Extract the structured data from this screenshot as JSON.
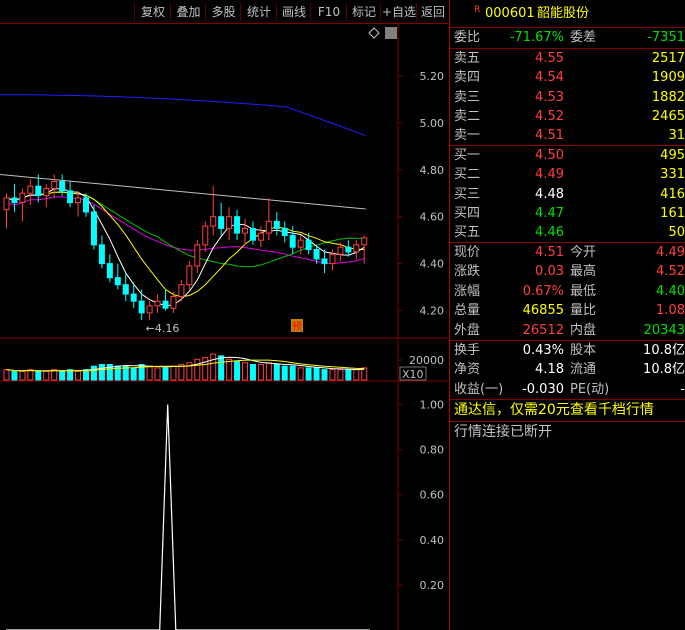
{
  "toolbar": {
    "buttons": [
      "复权",
      "叠加",
      "多股",
      "统计",
      "画线",
      "F10",
      "标记",
      "+自选",
      "返回"
    ]
  },
  "stock": {
    "badge": "R",
    "code": "000601",
    "name": "韶能股份"
  },
  "weibi": {
    "label1": "委比",
    "value1": "-71.67%",
    "label2": "委差",
    "value2": "-7351"
  },
  "asks": [
    {
      "label": "卖五",
      "price": "4.55",
      "vol": "2517"
    },
    {
      "label": "卖四",
      "price": "4.54",
      "vol": "1909"
    },
    {
      "label": "卖三",
      "price": "4.53",
      "vol": "1882"
    },
    {
      "label": "卖二",
      "price": "4.52",
      "vol": "2465"
    },
    {
      "label": "卖一",
      "price": "4.51",
      "vol": "31"
    }
  ],
  "bids": [
    {
      "label": "买一",
      "price": "4.50",
      "vol": "495"
    },
    {
      "label": "买二",
      "price": "4.49",
      "vol": "331"
    },
    {
      "label": "买三",
      "price": "4.48",
      "vol": "416"
    },
    {
      "label": "买四",
      "price": "4.47",
      "vol": "161"
    },
    {
      "label": "买五",
      "price": "4.46",
      "vol": "50"
    }
  ],
  "quote": [
    {
      "l1": "现价",
      "v1": "4.51",
      "l2": "今开",
      "v2": "4.49"
    },
    {
      "l1": "涨跌",
      "v1": "0.03",
      "l2": "最高",
      "v2": "4.52"
    },
    {
      "l1": "涨幅",
      "v1": "0.67%",
      "l2": "最低",
      "v2": "4.40"
    },
    {
      "l1": "总量",
      "v1": "46855",
      "l2": "量比",
      "v2": "1.08"
    },
    {
      "l1": "外盘",
      "v1": "26512",
      "l2": "内盘",
      "v2": "20343"
    }
  ],
  "finance": [
    {
      "l1": "换手",
      "v1": "0.43%",
      "l2": "股本",
      "v2": "10.8亿"
    },
    {
      "l1": "净资",
      "v1": "4.18",
      "l2": "流通",
      "v2": "10.8亿"
    },
    {
      "l1": "收益(一)",
      "v1": "-0.030",
      "l2": "PE(动)",
      "v2": "-"
    }
  ],
  "promo": "通达信，仅需20元查看千档行情",
  "status": "行情连接已断开",
  "colors": {
    "up": "#ff4040",
    "down": "#00e000",
    "ma5": "#ffffff",
    "ma10": "#ffff00",
    "ma20": "#00c000",
    "ma30": "#e000e0",
    "ma60": "#c0c0c0",
    "ma120": "#2020ff",
    "grid": "#800000"
  },
  "chart_data": {
    "type": "candlestick",
    "price_axis": {
      "ticks": [
        "5.20",
        "5.00",
        "4.80",
        "4.60",
        "4.40",
        "4.20"
      ],
      "range": [
        4.1,
        5.4
      ]
    },
    "low_marker": "4.16",
    "event_tag": "预",
    "volume_axis": {
      "tick": "20000",
      "unit": "X10"
    },
    "indicator_axis": {
      "ticks": [
        "1.00",
        "0.80",
        "0.60",
        "0.40",
        "0.20"
      ],
      "range": [
        0,
        1.1
      ]
    },
    "candles": [
      {
        "o": 4.63,
        "h": 4.7,
        "l": 4.55,
        "c": 4.68
      },
      {
        "o": 4.68,
        "h": 4.74,
        "l": 4.62,
        "c": 4.66
      },
      {
        "o": 4.66,
        "h": 4.72,
        "l": 4.58,
        "c": 4.7
      },
      {
        "o": 4.7,
        "h": 4.76,
        "l": 4.65,
        "c": 4.73
      },
      {
        "o": 4.73,
        "h": 4.78,
        "l": 4.66,
        "c": 4.69
      },
      {
        "o": 4.69,
        "h": 4.74,
        "l": 4.64,
        "c": 4.72
      },
      {
        "o": 4.72,
        "h": 4.78,
        "l": 4.68,
        "c": 4.75
      },
      {
        "o": 4.75,
        "h": 4.78,
        "l": 4.69,
        "c": 4.71
      },
      {
        "o": 4.71,
        "h": 4.75,
        "l": 4.64,
        "c": 4.66
      },
      {
        "o": 4.66,
        "h": 4.71,
        "l": 4.6,
        "c": 4.68
      },
      {
        "o": 4.68,
        "h": 4.7,
        "l": 4.6,
        "c": 4.62
      },
      {
        "o": 4.62,
        "h": 4.65,
        "l": 4.46,
        "c": 4.48
      },
      {
        "o": 4.48,
        "h": 4.52,
        "l": 4.38,
        "c": 4.4
      },
      {
        "o": 4.4,
        "h": 4.44,
        "l": 4.32,
        "c": 4.34
      },
      {
        "o": 4.34,
        "h": 4.4,
        "l": 4.29,
        "c": 4.31
      },
      {
        "o": 4.31,
        "h": 4.36,
        "l": 4.24,
        "c": 4.27
      },
      {
        "o": 4.27,
        "h": 4.32,
        "l": 4.21,
        "c": 4.24
      },
      {
        "o": 4.24,
        "h": 4.29,
        "l": 4.16,
        "c": 4.19
      },
      {
        "o": 4.19,
        "h": 4.24,
        "l": 4.16,
        "c": 4.22
      },
      {
        "o": 4.22,
        "h": 4.27,
        "l": 4.19,
        "c": 4.24
      },
      {
        "o": 4.24,
        "h": 4.29,
        "l": 4.2,
        "c": 4.21
      },
      {
        "o": 4.21,
        "h": 4.28,
        "l": 4.19,
        "c": 4.26
      },
      {
        "o": 4.26,
        "h": 4.33,
        "l": 4.24,
        "c": 4.31
      },
      {
        "o": 4.31,
        "h": 4.41,
        "l": 4.29,
        "c": 4.39
      },
      {
        "o": 4.39,
        "h": 4.5,
        "l": 4.36,
        "c": 4.48
      },
      {
        "o": 4.48,
        "h": 4.58,
        "l": 4.45,
        "c": 4.56
      },
      {
        "o": 4.56,
        "h": 4.73,
        "l": 4.52,
        "c": 4.6
      },
      {
        "o": 4.6,
        "h": 4.66,
        "l": 4.52,
        "c": 4.55
      },
      {
        "o": 4.55,
        "h": 4.64,
        "l": 4.5,
        "c": 4.6
      },
      {
        "o": 4.6,
        "h": 4.63,
        "l": 4.5,
        "c": 4.53
      },
      {
        "o": 4.53,
        "h": 4.59,
        "l": 4.48,
        "c": 4.55
      },
      {
        "o": 4.55,
        "h": 4.58,
        "l": 4.48,
        "c": 4.5
      },
      {
        "o": 4.5,
        "h": 4.56,
        "l": 4.47,
        "c": 4.53
      },
      {
        "o": 4.53,
        "h": 4.68,
        "l": 4.5,
        "c": 4.58
      },
      {
        "o": 4.58,
        "h": 4.62,
        "l": 4.52,
        "c": 4.55
      },
      {
        "o": 4.55,
        "h": 4.58,
        "l": 4.49,
        "c": 4.52
      },
      {
        "o": 4.52,
        "h": 4.56,
        "l": 4.44,
        "c": 4.47
      },
      {
        "o": 4.47,
        "h": 4.52,
        "l": 4.44,
        "c": 4.5
      },
      {
        "o": 4.5,
        "h": 4.53,
        "l": 4.44,
        "c": 4.46
      },
      {
        "o": 4.46,
        "h": 4.48,
        "l": 4.4,
        "c": 4.42
      },
      {
        "o": 4.42,
        "h": 4.46,
        "l": 4.36,
        "c": 4.4
      },
      {
        "o": 4.4,
        "h": 4.46,
        "l": 4.37,
        "c": 4.44
      },
      {
        "o": 4.44,
        "h": 4.49,
        "l": 4.41,
        "c": 4.47
      },
      {
        "o": 4.47,
        "h": 4.5,
        "l": 4.43,
        "c": 4.45
      },
      {
        "o": 4.45,
        "h": 4.5,
        "l": 4.42,
        "c": 4.48
      },
      {
        "o": 4.48,
        "h": 4.52,
        "l": 4.4,
        "c": 4.51
      }
    ],
    "volumes": [
      6,
      5,
      5,
      6,
      5,
      5,
      6,
      5,
      6,
      5,
      6,
      8,
      9,
      9,
      8,
      8,
      7,
      9,
      8,
      7,
      7,
      8,
      9,
      10,
      12,
      13,
      15,
      14,
      12,
      11,
      10,
      9,
      9,
      10,
      9,
      8,
      8,
      7,
      7,
      7,
      6,
      6,
      6,
      6,
      6,
      7
    ],
    "indicator": [
      0,
      0,
      0,
      0,
      0,
      0,
      0,
      0,
      0,
      0,
      0,
      0,
      0,
      0,
      0,
      0,
      0,
      0,
      0,
      0,
      1,
      0,
      0,
      0,
      0,
      0,
      0,
      0,
      0,
      0,
      0,
      0,
      0,
      0,
      0,
      0,
      0,
      0,
      0,
      0,
      0,
      0,
      0,
      0,
      0,
      0
    ]
  }
}
